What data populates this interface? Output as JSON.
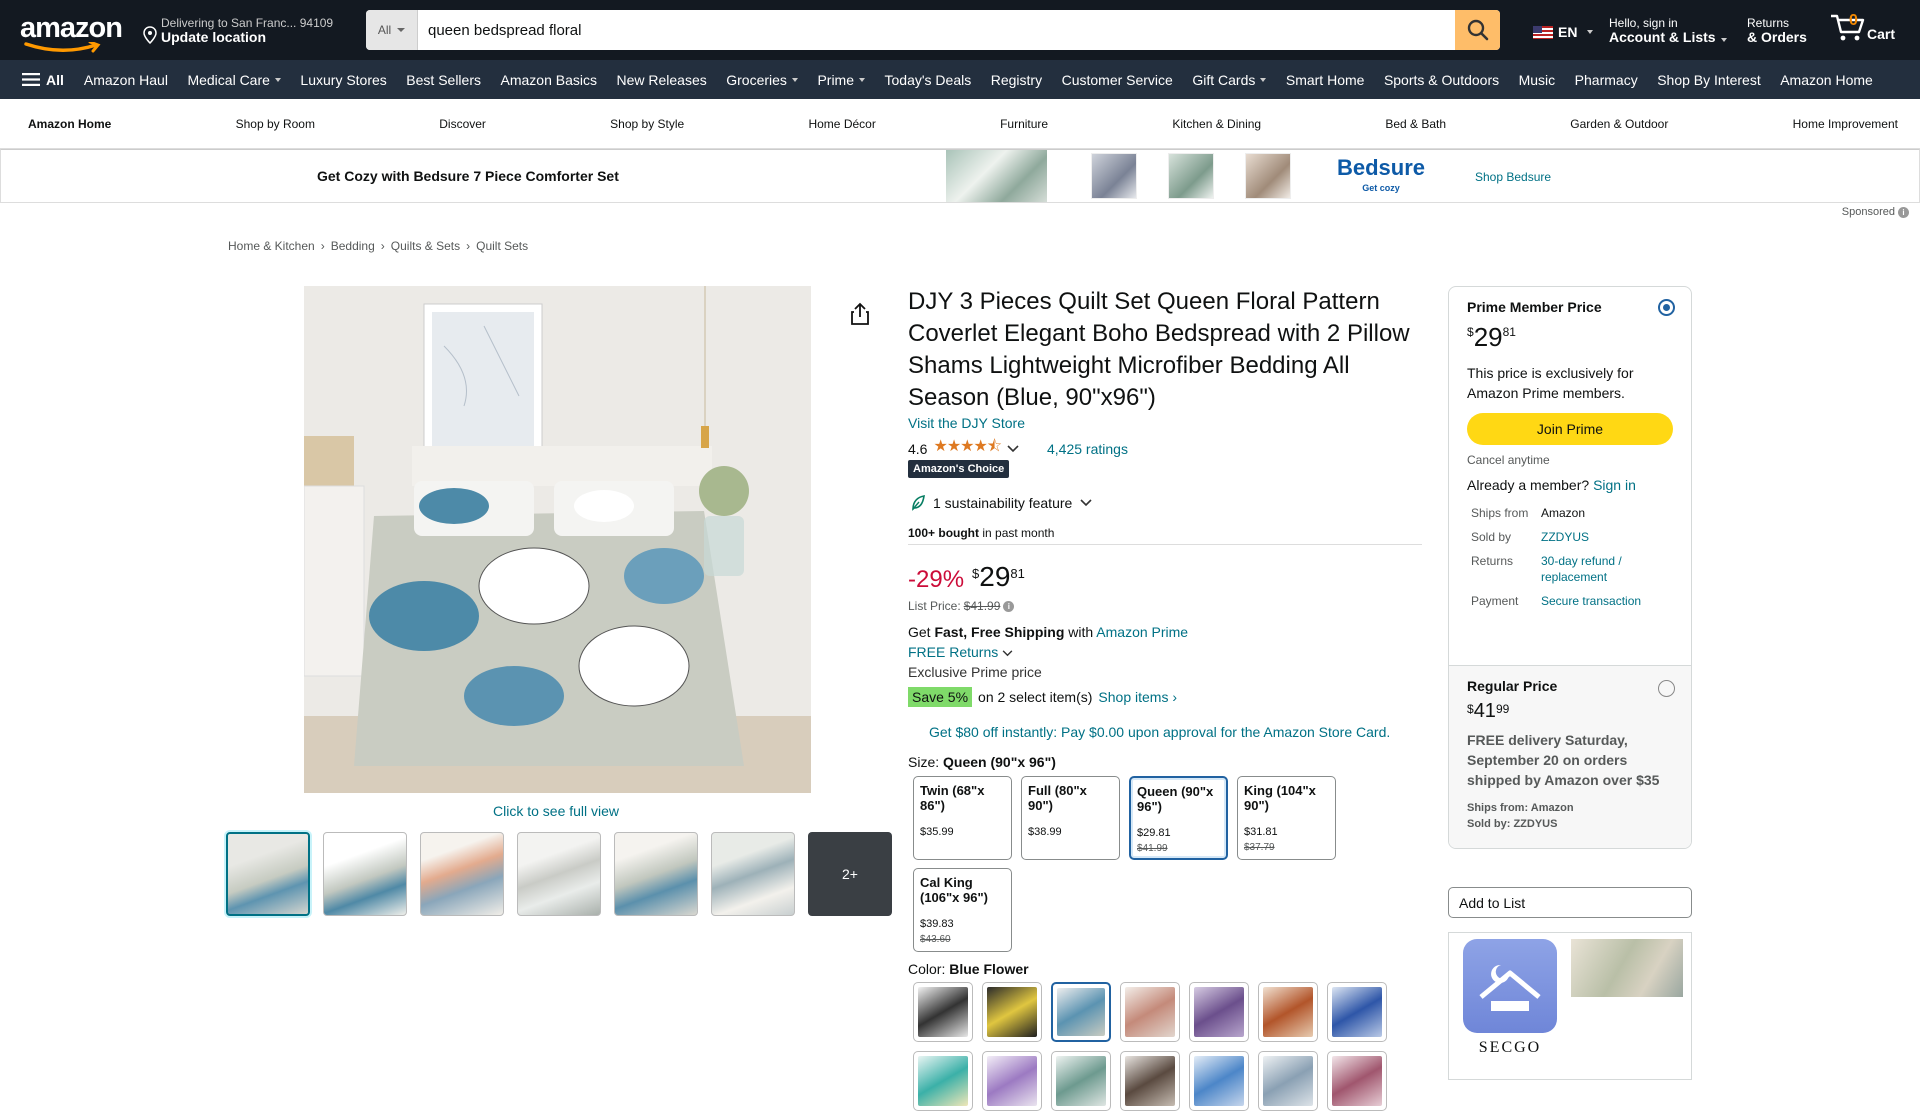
{
  "header": {
    "deliver_line1": "Delivering to San Franc... 94109",
    "deliver_line2": "Update location",
    "search_category": "All",
    "search_value": "queen bedspread floral",
    "lang": "EN",
    "account_line1": "Hello, sign in",
    "account_line2": "Account & Lists",
    "orders_line1": "Returns",
    "orders_line2": "& Orders",
    "cart_count": "0",
    "cart_label": "Cart"
  },
  "subnav": {
    "all": "All",
    "items": [
      "Amazon Haul",
      "Medical Care",
      "Luxury Stores",
      "Best Sellers",
      "Amazon Basics",
      "New Releases",
      "Groceries",
      "Prime",
      "Today's Deals",
      "Registry",
      "Customer Service",
      "Gift Cards",
      "Smart Home",
      "Sports & Outdoors",
      "Music",
      "Pharmacy",
      "Shop By Interest",
      "Amazon Home"
    ]
  },
  "storenav": [
    "Amazon Home",
    "Shop by Room",
    "Discover",
    "Shop by Style",
    "Home Décor",
    "Furniture",
    "Kitchen & Dining",
    "Bed & Bath",
    "Garden & Outdoor",
    "Home Improvement"
  ],
  "banner": {
    "text": "Get Cozy with Bedsure 7 Piece Comforter Set",
    "brand": "Bedsure",
    "brand_tag": "Get cozy",
    "shop_link": "Shop Bedsure",
    "sponsored": "Sponsored"
  },
  "breadcrumb": [
    "Home & Kitchen",
    "Bedding",
    "Quilts & Sets",
    "Quilt Sets"
  ],
  "gallery": {
    "full_view": "Click to see full view",
    "more": "2+"
  },
  "product": {
    "title": "DJY 3 Pieces Quilt Set Queen Floral Pattern Coverlet Elegant Boho Bedspread with 2 Pillow Shams Lightweight Microfiber Bedding All Season (Blue, 90\"x96\")",
    "store": "Visit the DJY Store",
    "rating": "4.6",
    "stars": "★★★★⯪",
    "ratings_count": "4,425 ratings",
    "choice": "Amazon's Choice",
    "sustainability": "1 sustainability feature",
    "bought_bold": "100+ bought",
    "bought_rest": " in past month",
    "discount": "-29%",
    "price_symbol": "$",
    "price_whole": "29",
    "price_fraction": "81",
    "list_price_label": "List Price:",
    "list_price": "$41.99",
    "shipping_pre": "Get ",
    "shipping_bold": "Fast, Free Shipping",
    "shipping_mid": " with ",
    "shipping_link": "Amazon Prime",
    "free_returns": "FREE Returns",
    "exclusive": "Exclusive Prime price",
    "save_badge": "Save 5%",
    "save_text": "on 2 select item(s)",
    "shop_items": "Shop items ›",
    "card_offer": "Get $80 off instantly: Pay $0.00 upon approval for the Amazon Store Card.",
    "size_label": "Size:",
    "size_selected": "Queen (90\"x 96\")",
    "color_label": "Color:",
    "color_selected": "Blue Flower"
  },
  "sizes": [
    {
      "name": "Twin (68\"x 86\")",
      "price": "$35.99",
      "old": ""
    },
    {
      "name": "Full (80\"x 90\")",
      "price": "$38.99",
      "old": ""
    },
    {
      "name": "Queen (90\"x 96\")",
      "price": "$29.81",
      "old": "$41.99"
    },
    {
      "name": "King (104\"x 90\")",
      "price": "$31.81",
      "old": "$37.79"
    },
    {
      "name": "Cal King (106\"x 96\")",
      "price": "$39.83",
      "old": "$43.60"
    }
  ],
  "buybox": {
    "prime_heading": "Prime Member Price",
    "prime_symbol": "$",
    "prime_whole": "29",
    "prime_frac": "81",
    "prime_text": "This price is exclusively for Amazon Prime members.",
    "join": "Join Prime",
    "cancel": "Cancel anytime",
    "already": "Already a member?",
    "signin": "Sign in",
    "ships_from_k": "Ships from",
    "ships_from_v": "Amazon",
    "sold_by_k": "Sold by",
    "sold_by_v": "ZZDYUS",
    "returns_k": "Returns",
    "returns_v": "30-day refund / replacement",
    "payment_k": "Payment",
    "payment_v": "Secure transaction",
    "regular_heading": "Regular Price",
    "regular_symbol": "$",
    "regular_whole": "41",
    "regular_frac": "99",
    "regular_delivery": "FREE delivery Saturday, September 20 on orders shipped by Amazon over $35",
    "regular_ships": "Ships from: Amazon",
    "regular_sold": "Sold by: ZZDYUS",
    "add_to_list": "Add to List",
    "ad_brand": "SECGO"
  }
}
